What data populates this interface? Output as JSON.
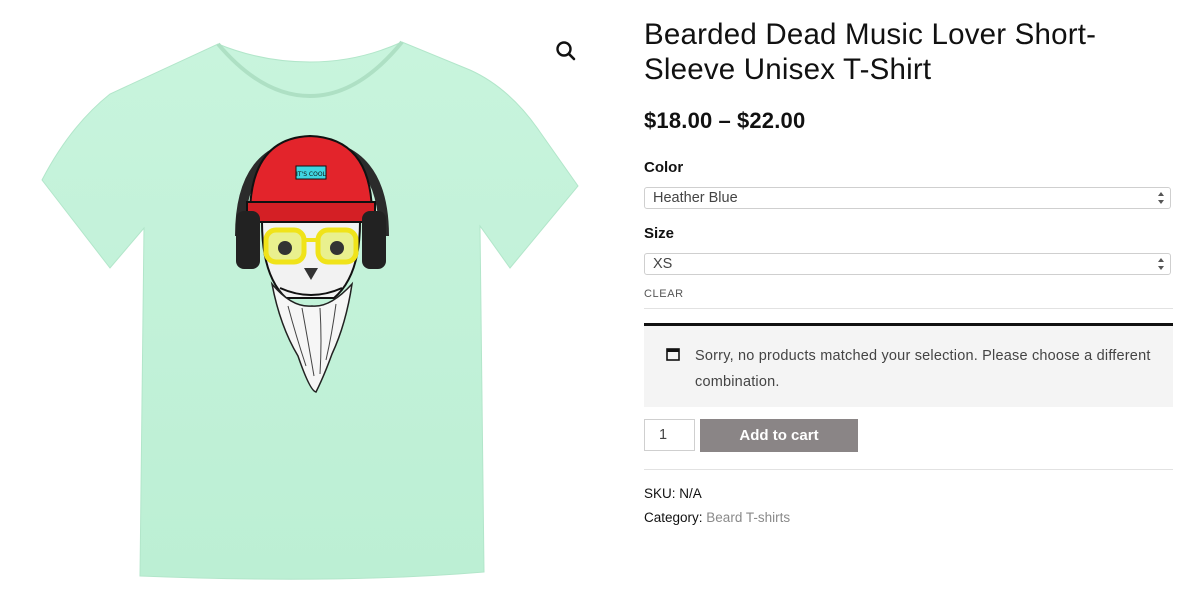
{
  "product": {
    "title": "Bearded Dead Music Lover Short-Sleeve Unisex T-Shirt",
    "price_min": "$18.00",
    "price_sep": "–",
    "price_max": "$22.00",
    "image_bg_color": "#c6f3db",
    "logo_on_hat": "IT'S COOL"
  },
  "variations": {
    "color_label": "Color",
    "color_value": "Heather Blue",
    "size_label": "Size",
    "size_value": "XS",
    "clear_label": "CLEAR"
  },
  "notice": {
    "icon": "window-icon",
    "message": "Sorry, no products matched your selection. Please choose a different combination."
  },
  "cart": {
    "quantity": "1",
    "add_label": "Add to cart",
    "button_color": "#8a8586"
  },
  "meta": {
    "sku_label": "SKU:",
    "sku_value": "N/A",
    "category_label": "Category:",
    "category_value": "Beard T-shirts"
  },
  "icons": {
    "zoom": "magnifier-icon"
  }
}
